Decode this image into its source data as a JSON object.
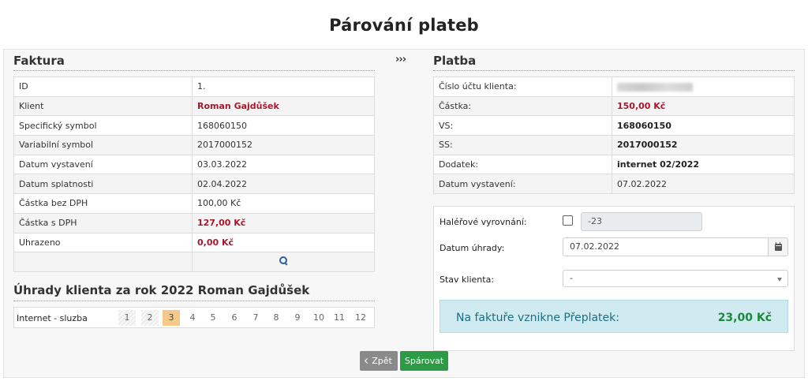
{
  "page": {
    "title": "Párování plateb"
  },
  "faktura": {
    "title": "Faktura",
    "rows": [
      {
        "label": "ID",
        "value": "1."
      },
      {
        "label": "Klient",
        "value": "Roman Gajdůšek"
      },
      {
        "label": "Specifický symbol",
        "value": "168060150"
      },
      {
        "label": "Variabilní symbol",
        "value": "2017000152"
      },
      {
        "label": "Datum vystavení",
        "value": "03.03.2022"
      },
      {
        "label": "Datum splatnosti",
        "value": "02.04.2022"
      },
      {
        "label": "Částka bez DPH",
        "value": "100,00 Kč"
      },
      {
        "label": "Částka s DPH",
        "value": "127,00 Kč"
      },
      {
        "label": "Uhrazeno",
        "value": "0,00 Kč"
      }
    ]
  },
  "arrows": "›››",
  "platba": {
    "title": "Platba",
    "rows": [
      {
        "label": "Číslo účtu klienta:",
        "value": ""
      },
      {
        "label": "Částka:",
        "value": "150,00 Kč"
      },
      {
        "label": "VS:",
        "value": "168060150"
      },
      {
        "label": "SS:",
        "value": "2017000152"
      },
      {
        "label": "Dodatek:",
        "value": "internet 02/2022"
      },
      {
        "label": "Datum vystavení:",
        "value": "07.02.2022"
      }
    ]
  },
  "uhrady": {
    "title": "Úhrady klienta za rok 2022 Roman Gajdůšek",
    "service": "Internet - sluzba",
    "months": [
      "1",
      "2",
      "3",
      "4",
      "5",
      "6",
      "7",
      "8",
      "9",
      "10",
      "11",
      "12"
    ]
  },
  "form": {
    "rounding_label": "Haléřové vyrovnání:",
    "rounding_value": "-23",
    "payment_date_label": "Datum úhrady:",
    "payment_date_value": "07.02.2022",
    "client_state_label": "Stav klienta:",
    "client_state_value": "-"
  },
  "summary": {
    "text": "Na faktuře vznikne Přeplatek:",
    "value": "23,00 Kč"
  },
  "buttons": {
    "back": "Zpět",
    "pair": "Spárovat"
  }
}
